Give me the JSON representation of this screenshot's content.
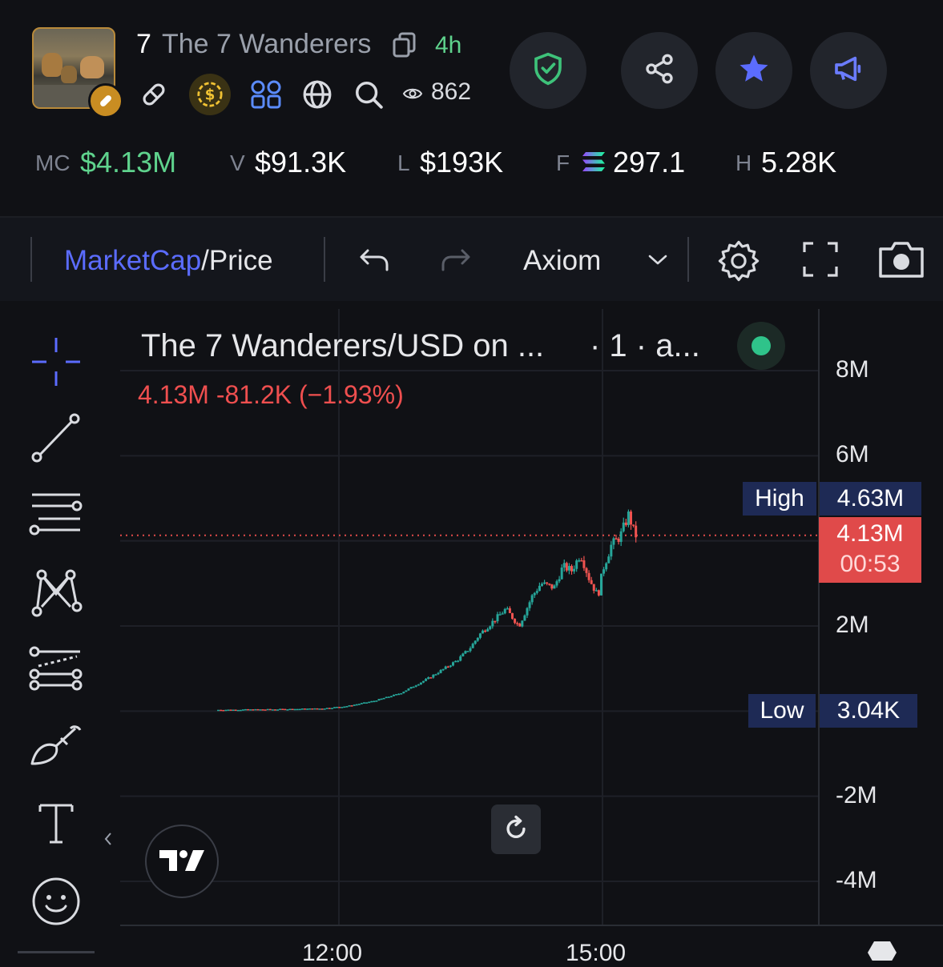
{
  "header": {
    "ticker": "7",
    "name": "The 7 Wanderers",
    "age": "4h",
    "views": "862"
  },
  "stats": {
    "mc_label": "MC",
    "mc_value": "$4.13M",
    "v_label": "V",
    "v_value": "$91.3K",
    "l_label": "L",
    "l_value": "$193K",
    "f_label": "F",
    "f_value": "297.1",
    "h_label": "H",
    "h_value": "5.28K"
  },
  "toolbar": {
    "marketcap": "MarketCap",
    "slash_price": "/Price",
    "source": "Axiom"
  },
  "chart": {
    "title": "The 7 Wanderers/USD on ...",
    "interval": "· 1 · a...",
    "ohlc": "4.13M  -81.2K (−1.93%)",
    "high_tag": "High",
    "high_value": "4.63M",
    "current_value": "4.13M",
    "countdown": "00:53",
    "low_tag": "Low",
    "low_value": "3.04K",
    "y_ticks": [
      "8M",
      "6M",
      "2M",
      "-2M",
      "-4M"
    ],
    "x_ticks": [
      "12:00",
      "15:00"
    ]
  },
  "colors": {
    "up": "#26a69a",
    "down": "#ef5350",
    "accent": "#5b6cff",
    "positive": "#5fd38d"
  },
  "chart_data": {
    "type": "line",
    "title": "The 7 Wanderers/USD on ...",
    "xlabel": "",
    "ylabel": "",
    "ylim": [
      -5000000,
      9000000
    ],
    "x_ticks": [
      "12:00",
      "15:00"
    ],
    "y_ticks": [
      "8M",
      "6M",
      "2M",
      "-2M",
      "-4M"
    ],
    "series": [
      {
        "x": [
          10.6,
          11.2,
          11.8,
          12.1,
          12.4,
          12.7,
          13.0,
          13.2,
          13.35,
          13.5,
          13.6,
          13.75,
          13.9,
          14.05,
          14.2,
          14.3,
          14.45,
          14.55,
          14.65,
          14.75,
          14.85,
          14.95,
          15.0,
          15.1,
          15.2,
          15.3,
          15.35,
          15.38
        ],
        "y": [
          30000,
          40000,
          60000,
          120000,
          240000,
          420000,
          750000,
          1000000,
          1200000,
          1500000,
          1800000,
          2100000,
          2400000,
          2000000,
          2700000,
          3000000,
          2900000,
          3400000,
          3300000,
          3700000,
          3100000,
          2700000,
          3300000,
          3900000,
          4100000,
          4630000,
          4250000,
          4130000
        ]
      }
    ],
    "high": 4630000,
    "low": 3040,
    "current": 4130000
  }
}
